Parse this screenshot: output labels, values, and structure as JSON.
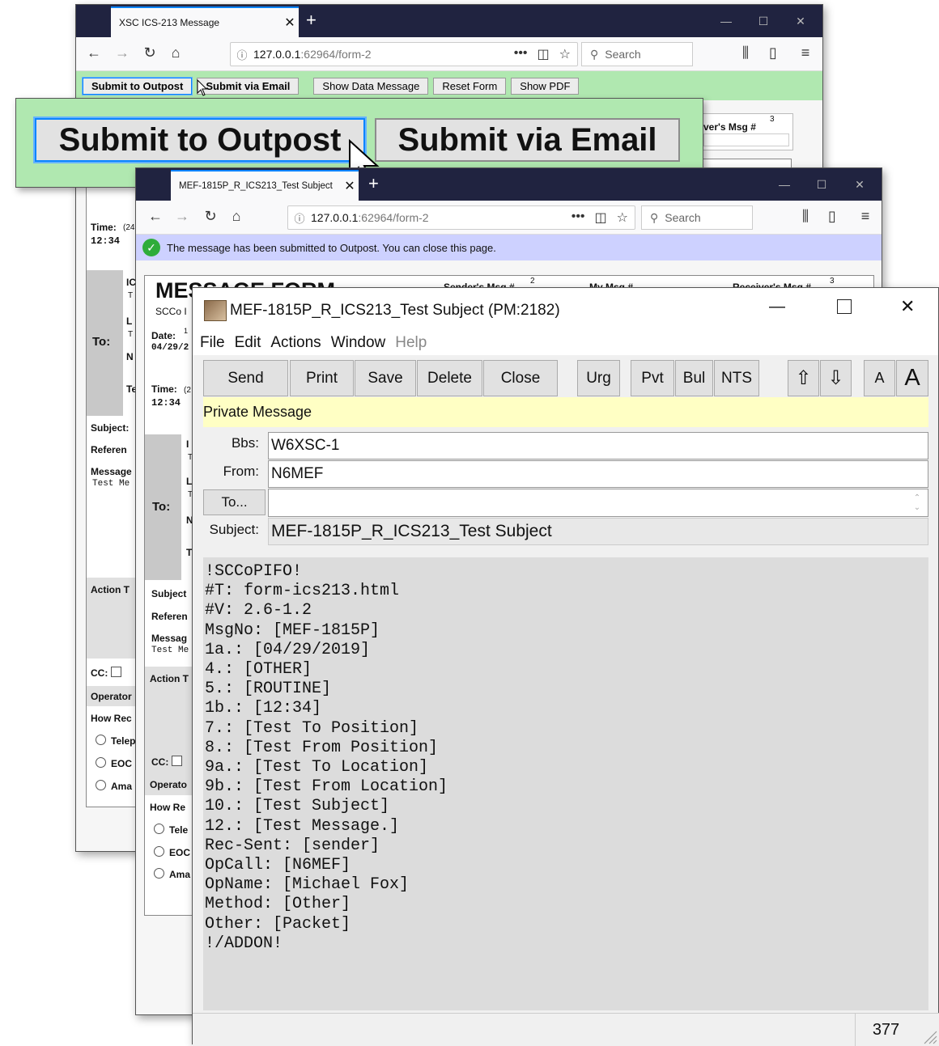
{
  "win1": {
    "tab_title": "XSC ICS-213 Message",
    "url_host": "127.0.0.1",
    "url_path": ":62964/form-2",
    "search_placeholder": "Search",
    "buttons": [
      "Submit to Outpost",
      "Submit via Email",
      "Show Data Message",
      "Reset Form",
      "Show PDF"
    ],
    "receivers_msg": "ver's Msg #",
    "receivers_sup": "3",
    "time_label": "Time:",
    "time_hint": "(24",
    "time_value": "12:34",
    "to_label": "To:",
    "frag": [
      "IC",
      "T",
      "L",
      "T",
      "N",
      "Te"
    ],
    "subject_label": "Subject:",
    "reference_label": "Referen",
    "message_label": "Message",
    "message_value": "Test Me",
    "action_label": "Action T",
    "cc_label": "CC:",
    "operator_label": "Operator",
    "how_received_label": "How Rec",
    "radios": [
      "Telep",
      "EOC",
      "Ama"
    ]
  },
  "zoom": {
    "buttons": [
      "Submit to Outpost",
      "Submit via Email"
    ]
  },
  "win2": {
    "tab_title": "MEF-1815P_R_ICS213_Test Subject",
    "url_host": "127.0.0.1",
    "url_path": ":62964/form-2",
    "search_placeholder": "Search",
    "notice": "The message has been submitted to Outpost. You can close this page.",
    "form_title": "MESSAGE FORM",
    "form_sub": "SCCo I",
    "senders_msg": "Sender's Msg #",
    "senders_sup": "2",
    "my_msg": "My Msg #",
    "receivers_msg": "Receiver's Msg #",
    "receivers_sup": "3",
    "date_label": "Date:",
    "date_sup": "1",
    "date_value": "04/29/2",
    "time_label": "Time:",
    "time_hint": "(2",
    "time_value": "12:34",
    "to_label": "To:",
    "frag": [
      "I",
      "T",
      "L",
      "T",
      "N",
      "T"
    ],
    "subject_label": "Subject",
    "reference_label": "Referen",
    "message_label": "Messag",
    "message_value": "Test Me",
    "action_label": "Action T",
    "cc_label": "CC:",
    "operator_label": "Operato",
    "how_received_label": "How Re",
    "radios": [
      "Tele",
      "EOC",
      "Ama"
    ]
  },
  "pm": {
    "title": "MEF-1815P_R_ICS213_Test Subject  (PM:2182)",
    "menu": [
      "File",
      "Edit",
      "Actions",
      "Window",
      "Help"
    ],
    "toolbar": {
      "send": "Send",
      "print": "Print",
      "save": "Save",
      "delete": "Delete",
      "close": "Close",
      "urg": "Urg",
      "pvt": "Pvt",
      "bul": "Bul",
      "nts": "NTS",
      "up": "⇧",
      "down": "⇩",
      "font_small": "A",
      "font_large": "A"
    },
    "banner": "Private Message",
    "bbs_label": "Bbs:",
    "bbs_value": "W6XSC-1",
    "from_label": "From:",
    "from_value": "N6MEF",
    "to_button": "To...",
    "to_value": "",
    "subject_label": "Subject:",
    "subject_value": "MEF-1815P_R_ICS213_Test Subject",
    "body_lines": [
      "!SCCoPIFO!",
      "#T: form-ics213.html",
      "#V: 2.6-1.2",
      "MsgNo: [MEF-1815P]",
      "1a.: [04/29/2019]",
      "4.: [OTHER]",
      "5.: [ROUTINE]",
      "1b.: [12:34]",
      "7.: [Test To Position]",
      "8.: [Test From Position]",
      "9a.: [Test To Location]",
      "9b.: [Test From Location]",
      "10.: [Test Subject]",
      "12.: [Test Message.]",
      "Rec-Sent: [sender]",
      "OpCall: [N6MEF]",
      "OpName: [Michael Fox]",
      "Method: [Other]",
      "Other: [Packet]",
      "!/ADDON!"
    ],
    "char_count": "377"
  }
}
